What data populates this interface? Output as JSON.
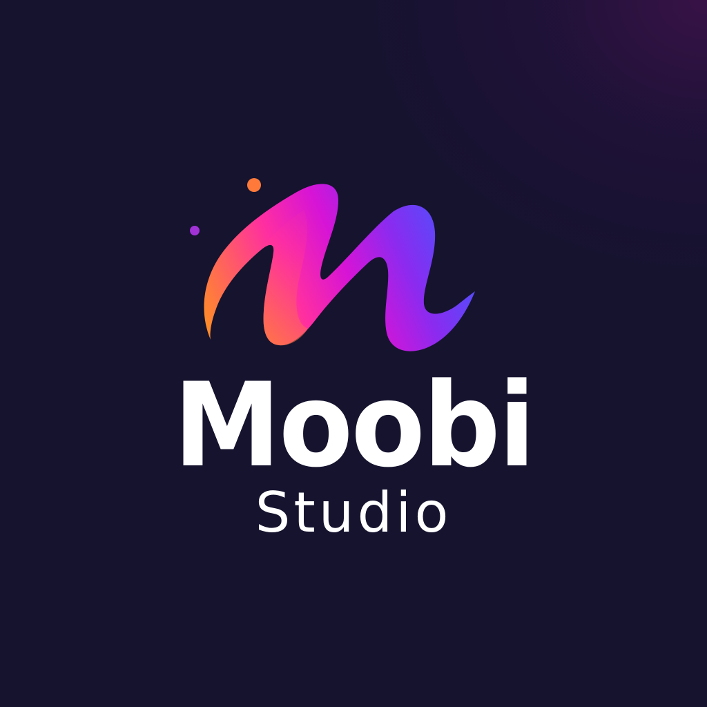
{
  "brand": {
    "name": "Moobi",
    "tagline": "Studio"
  },
  "logo": {
    "icon": "m-brush-stroke-icon",
    "accent_dots": [
      "orange-dot-icon",
      "purple-dot-icon"
    ]
  },
  "colors": {
    "background": "#15132e",
    "background_glow": "#3a1248",
    "text": "#ffffff",
    "gradient_orange": "#ff8a2a",
    "gradient_magenta": "#e414c8",
    "gradient_purple": "#8a2bf0",
    "gradient_blue": "#3b5cff"
  }
}
